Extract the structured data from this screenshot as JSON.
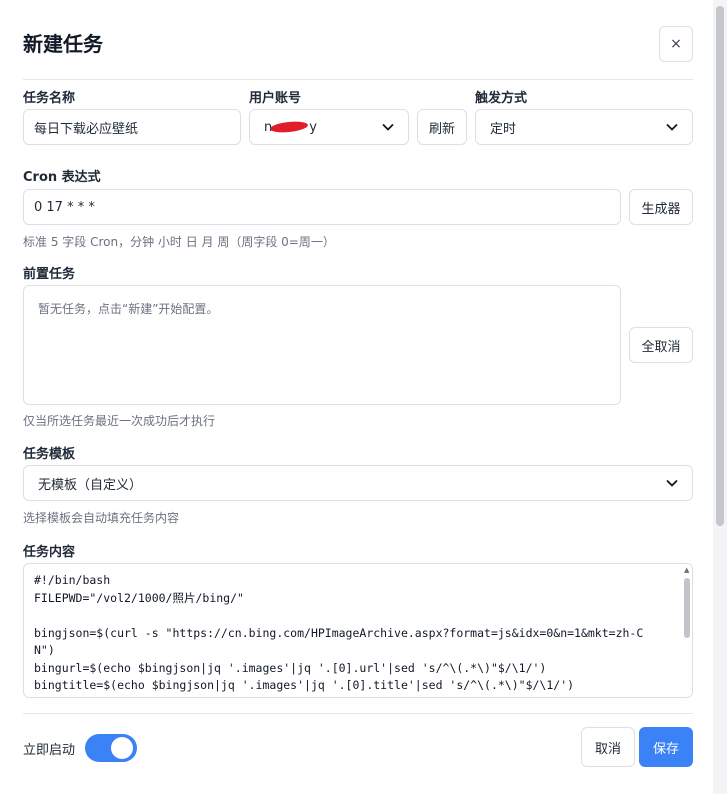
{
  "dialog": {
    "title": "新建任务",
    "close_icon": "×"
  },
  "task_name": {
    "label": "任务名称",
    "value": "每日下载必应壁纸"
  },
  "user_account": {
    "label": "用户账号",
    "value_prefix": "n",
    "value_suffix": "y",
    "refresh_label": "刷新"
  },
  "trigger": {
    "label": "触发方式",
    "value": "定时"
  },
  "cron": {
    "label": "Cron 表达式",
    "value": "0 17 * * *",
    "generator_label": "生成器",
    "hint": "标准 5 字段 Cron，分钟 小时 日 月 周（周字段 0=周一）"
  },
  "pre_task": {
    "label": "前置任务",
    "empty_text": "暂无任务，点击“新建”开始配置。",
    "cancel_all_label": "全取消",
    "hint": "仅当所选任务最近一次成功后才执行"
  },
  "template": {
    "label": "任务模板",
    "value": "无模板（自定义）",
    "hint": "选择模板会自动填充任务内容"
  },
  "content": {
    "label": "任务内容",
    "lines": [
      "#!/bin/bash",
      "FILEPWD=\"/vol2/1000/照片/bing/\"",
      "",
      "bingjson=$(curl -s \"https://cn.bing.com/HPImageArchive.aspx?format=js&idx=0&n=1&mkt=zh-CN\")",
      "bingurl=$(echo $bingjson|jq '.images'|jq '.[0].url'|sed 's/^\\(.*\\)\"$/\\1/')",
      "bingtitle=$(echo $bingjson|jq '.images'|jq '.[0].title'|sed 's/^\\(.*\\)\"$/\\1/')"
    ]
  },
  "footer": {
    "start_label": "立即启动",
    "start_enabled": true,
    "cancel_label": "取消",
    "save_label": "保存"
  },
  "colors": {
    "primary": "#3b82f6",
    "redaction": "#e11d2a",
    "border": "#dcdfe4"
  },
  "icons": {
    "select": "chevron-down-icon",
    "close": "close-icon"
  }
}
